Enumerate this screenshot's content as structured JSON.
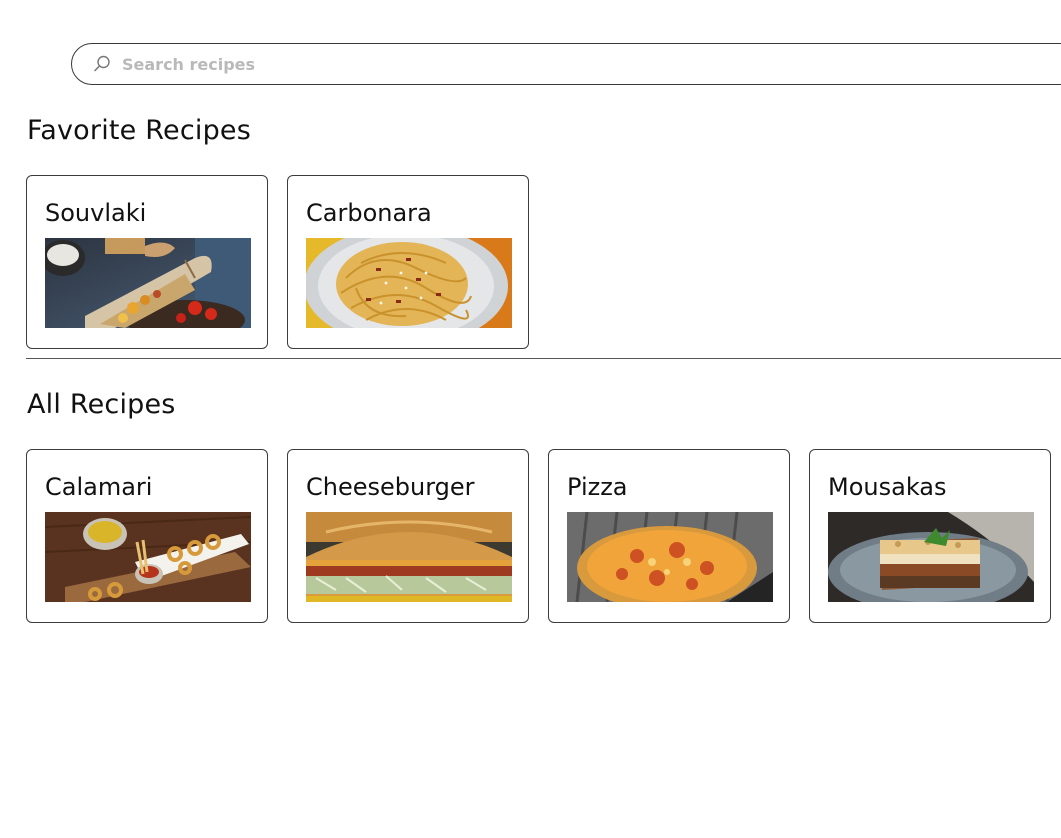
{
  "search": {
    "placeholder": "Search recipes",
    "value": ""
  },
  "favorites": {
    "title": "Favorite Recipes",
    "recipes": [
      {
        "name": "Souvlaki",
        "image": "souvlaki-wrap-photo"
      },
      {
        "name": "Carbonara",
        "image": "carbonara-pasta-photo"
      }
    ]
  },
  "all": {
    "title": "All Recipes",
    "recipes": [
      {
        "name": "Calamari",
        "image": "fried-calamari-photo"
      },
      {
        "name": "Cheeseburger",
        "image": "cheeseburger-photo"
      },
      {
        "name": "Pizza",
        "image": "pizza-photo"
      },
      {
        "name": "Mousakas",
        "image": "mousakas-photo"
      }
    ]
  },
  "colors": {
    "border": "#3c3c3c",
    "placeholder": "#b9b9b9",
    "text": "#111111"
  }
}
